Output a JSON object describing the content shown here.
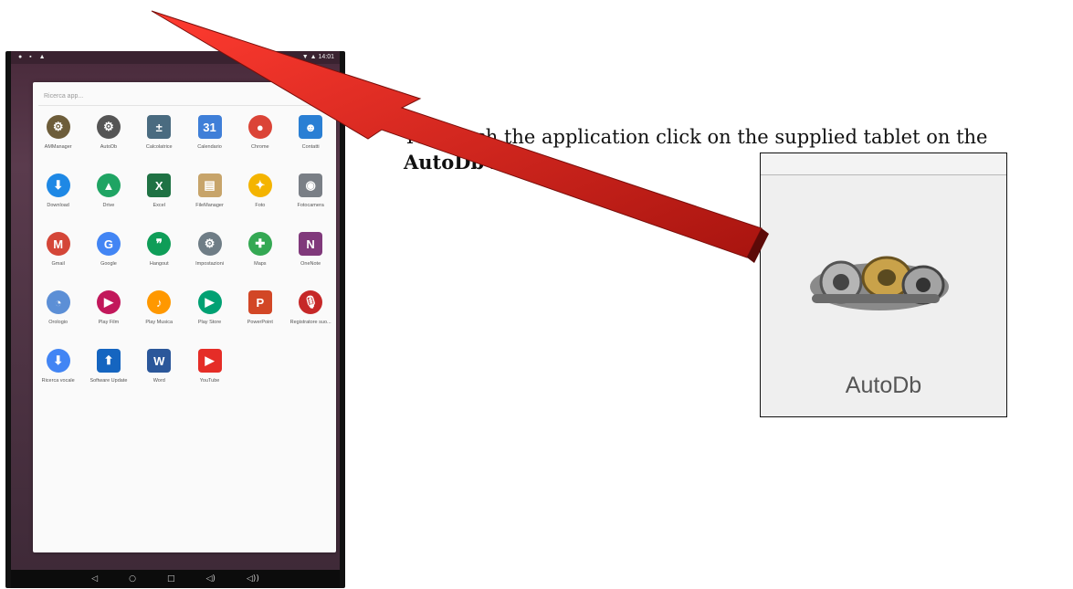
{
  "status_bar": {
    "left_icons": "● ▪ ▲",
    "right_text": "▼ ▲ 14:01"
  },
  "drawer": {
    "search_placeholder": "Ricerca app...",
    "apps": [
      {
        "label": "AMManager",
        "icon": "engine-icon",
        "color": "#6d5d3a",
        "glyph": "⚙"
      },
      {
        "label": "AutoDb",
        "icon": "engine-icon",
        "color": "#555555",
        "glyph": "⚙"
      },
      {
        "label": "Calcolatrice",
        "icon": "calculator-icon",
        "color": "#4a6b80",
        "glyph": "±"
      },
      {
        "label": "Calendario",
        "icon": "calendar-icon",
        "color": "#3f7fd8",
        "glyph": "31"
      },
      {
        "label": "Chrome",
        "icon": "chrome-icon",
        "color": "#db4437",
        "glyph": "●"
      },
      {
        "label": "Contatti",
        "icon": "contacts-icon",
        "color": "#2a7fd4",
        "glyph": "☻"
      },
      {
        "label": "Download",
        "icon": "download-icon",
        "color": "#1e88e5",
        "glyph": "⬇"
      },
      {
        "label": "Drive",
        "icon": "drive-icon",
        "color": "#1fa463",
        "glyph": "▲"
      },
      {
        "label": "Excel",
        "icon": "excel-icon",
        "color": "#1f7244",
        "glyph": "X"
      },
      {
        "label": "FileManager",
        "icon": "folder-icon",
        "color": "#c7a46a",
        "glyph": "▤"
      },
      {
        "label": "Foto",
        "icon": "pinwheel-icon",
        "color": "#f4b400",
        "glyph": "✦"
      },
      {
        "label": "Fotocamera",
        "icon": "camera-icon",
        "color": "#7a7f86",
        "glyph": "◉"
      },
      {
        "label": "Gmail",
        "icon": "gmail-icon",
        "color": "#d44638",
        "glyph": "M"
      },
      {
        "label": "Google",
        "icon": "google-icon",
        "color": "#4285f4",
        "glyph": "G"
      },
      {
        "label": "Hangout",
        "icon": "hangouts-icon",
        "color": "#0f9d58",
        "glyph": "❞"
      },
      {
        "label": "Impostazioni",
        "icon": "gear-icon",
        "color": "#6f7d86",
        "glyph": "⚙"
      },
      {
        "label": "Maps",
        "icon": "map-pin-icon",
        "color": "#34a853",
        "glyph": "✚"
      },
      {
        "label": "OneNote",
        "icon": "onenote-icon",
        "color": "#80397b",
        "glyph": "N"
      },
      {
        "label": "Orologio",
        "icon": "clock-icon",
        "color": "#5c8fd6",
        "glyph": "◔"
      },
      {
        "label": "Play Film",
        "icon": "play-film-icon",
        "color": "#c2185b",
        "glyph": "▶"
      },
      {
        "label": "Play Musica",
        "icon": "play-music-icon",
        "color": "#ff9800",
        "glyph": "♪"
      },
      {
        "label": "Play Store",
        "icon": "play-store-icon",
        "color": "#00a173",
        "glyph": "▶"
      },
      {
        "label": "PowerPoint",
        "icon": "powerpoint-icon",
        "color": "#d24726",
        "glyph": "P"
      },
      {
        "label": "Registratore suo...",
        "icon": "microphone-icon",
        "color": "#c62828",
        "glyph": "🎙"
      },
      {
        "label": "Ricerca vocale",
        "icon": "microphone-icon",
        "color": "#4285f4",
        "glyph": "⬇"
      },
      {
        "label": "Software Update",
        "icon": "update-arrow-icon",
        "color": "#1565c0",
        "glyph": "⬆"
      },
      {
        "label": "Word",
        "icon": "word-icon",
        "color": "#2b579a",
        "glyph": "W"
      },
      {
        "label": "YouTube",
        "icon": "youtube-icon",
        "color": "#e52d27",
        "glyph": "▶"
      }
    ]
  },
  "nav": {
    "back": "◁",
    "home": "○",
    "recents": "□",
    "vol_down": "◁)",
    "vol_up": "◁))"
  },
  "instruction": {
    "prefix": "To launch the application click on the supplied tablet on the ",
    "bold": "AutoDb",
    "suffix": " icon"
  },
  "zoom": {
    "label": "AutoDb"
  },
  "arrow_color": "#d8201c"
}
